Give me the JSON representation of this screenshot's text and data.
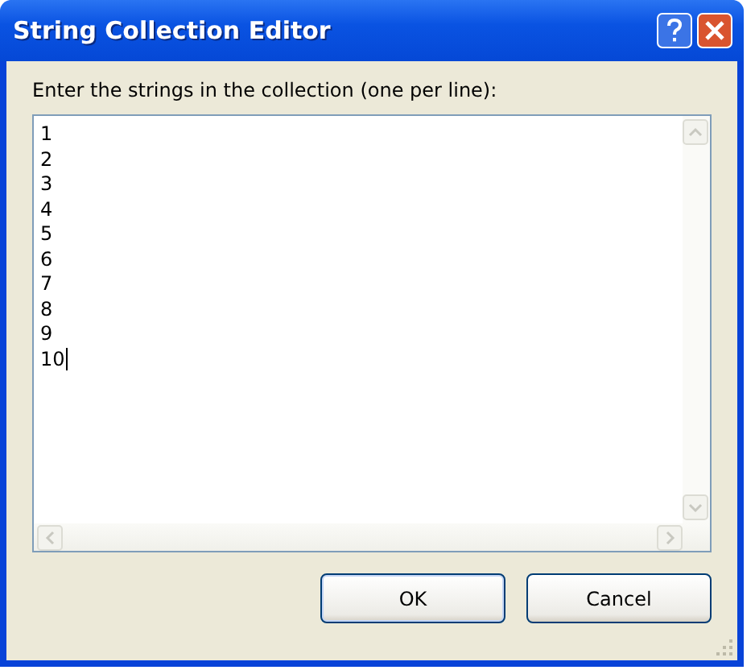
{
  "window": {
    "title": "String Collection Editor"
  },
  "prompt": "Enter the strings in the collection (one per line):",
  "lines": [
    {
      "text": "1",
      "caret": false
    },
    {
      "text": "2",
      "caret": false
    },
    {
      "text": "3",
      "caret": false
    },
    {
      "text": "4",
      "caret": false
    },
    {
      "text": "5",
      "caret": false
    },
    {
      "text": "6",
      "caret": false
    },
    {
      "text": "7",
      "caret": false
    },
    {
      "text": "8",
      "caret": false
    },
    {
      "text": "9",
      "caret": false
    },
    {
      "text": "10",
      "caret": true
    }
  ],
  "buttons": [
    {
      "label": "OK",
      "kind": "ok"
    },
    {
      "label": "Cancel",
      "kind": "cancel"
    }
  ]
}
